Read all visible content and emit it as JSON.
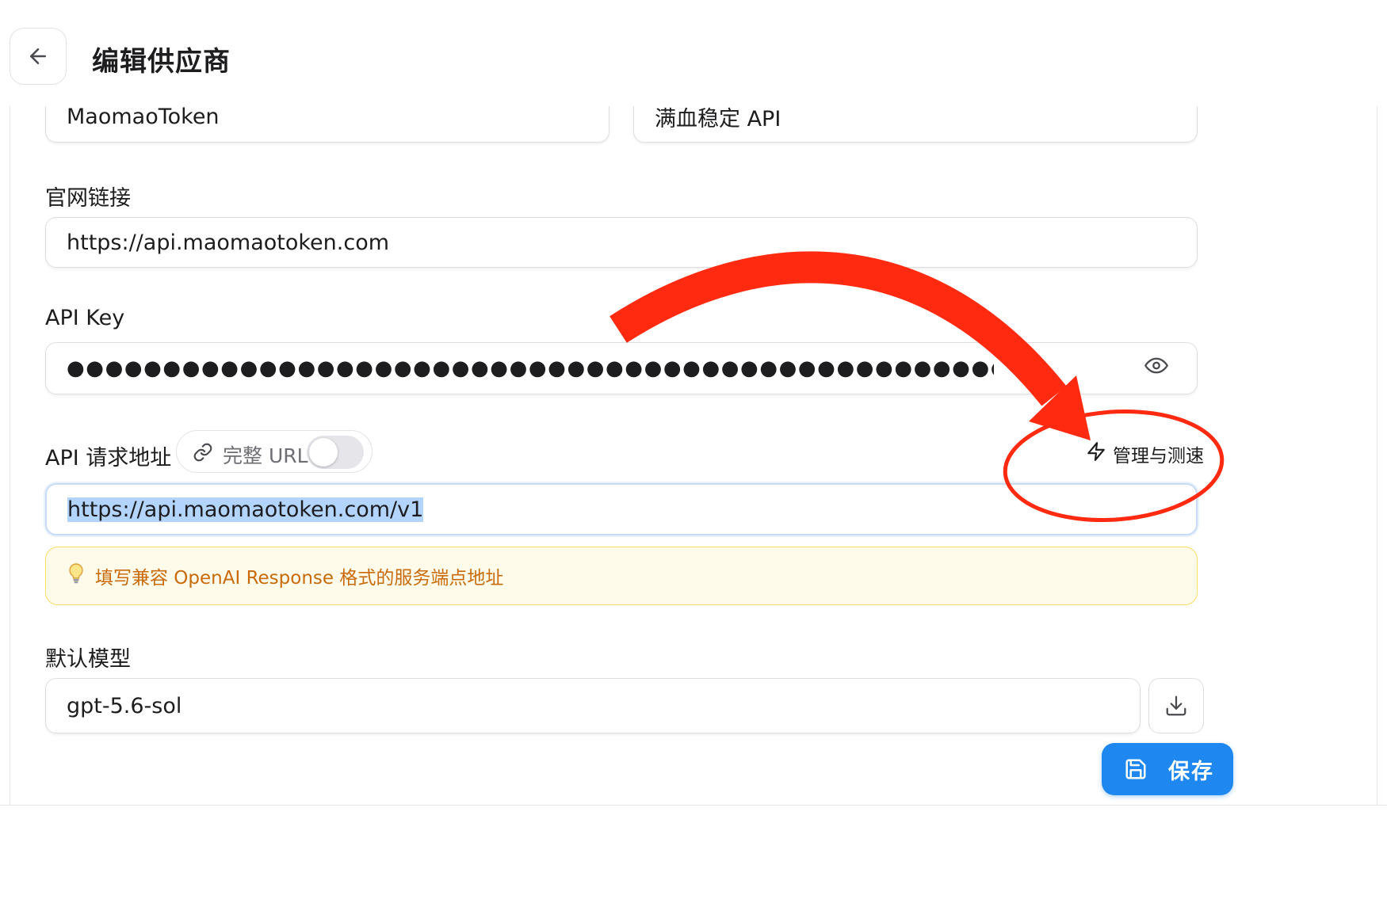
{
  "header": {
    "title": "编辑供应商"
  },
  "form": {
    "name_value": "MaomaoToken",
    "note_value": "满血稳定 API",
    "website_label": "官网链接",
    "website_value": "https://api.maomaotoken.com",
    "apikey_label": "API Key",
    "apikey_masked": "●●●●●●●●●●●●●●●●●●●●●●●●●●●●●●●●●●●●●●●●●●●●●●●●●●●●●●●●●●●●●●●●●●",
    "endpoint_label": "API 请求地址",
    "full_url_toggle_label": "完整 URL",
    "full_url_toggle_on": false,
    "manage_link_label": "管理与测速",
    "endpoint_value": "https://api.maomaotoken.com/v1",
    "endpoint_hint": "填写兼容 OpenAI Response 格式的服务端点地址",
    "model_label": "默认模型",
    "model_value": "gpt-5.6-sol"
  },
  "footer": {
    "save_label": "保存"
  },
  "colors": {
    "primary": "#1e87f0",
    "hint_text": "#c96a0b",
    "hint_bg": "#fefbeb",
    "annotation_red": "#ff2a10"
  },
  "icons": [
    "back-arrow-icon",
    "eye-icon",
    "link-icon",
    "bolt-icon",
    "lightbulb-icon",
    "download-icon",
    "save-icon"
  ]
}
